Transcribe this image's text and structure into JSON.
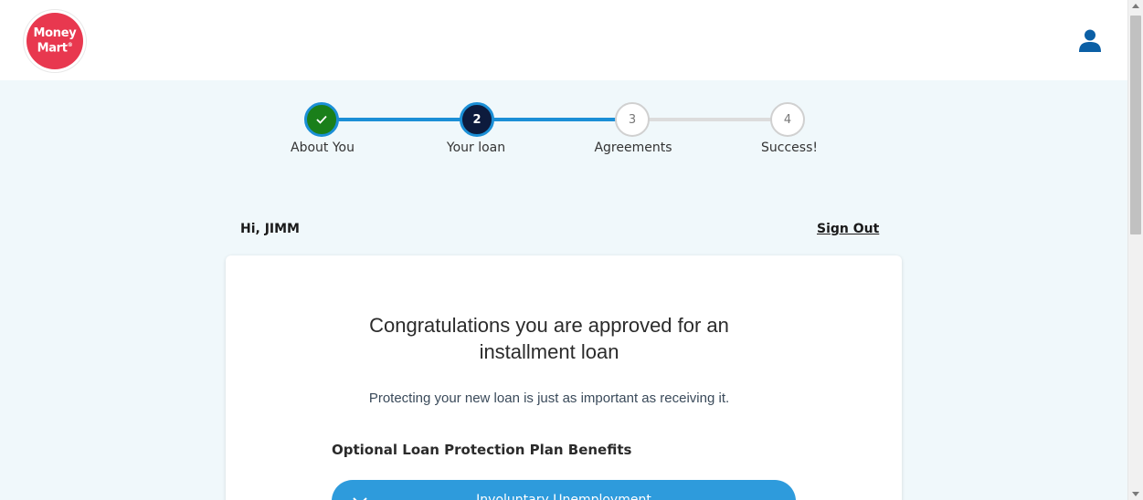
{
  "header": {
    "logo_line1": "Money",
    "logo_line2": "Mart",
    "logo_mark": "®"
  },
  "stepper": {
    "steps": [
      {
        "number": "✓",
        "label": "About You",
        "state": "complete"
      },
      {
        "number": "2",
        "label": "Your loan",
        "state": "current"
      },
      {
        "number": "3",
        "label": "Agreements",
        "state": "upcoming"
      },
      {
        "number": "4",
        "label": "Success!",
        "state": "upcoming"
      }
    ]
  },
  "account": {
    "greeting": "Hi, JIMM",
    "sign_out": "Sign Out"
  },
  "card": {
    "title_line1": "Congratulations you are approved for an",
    "title_line2": "installment loan",
    "subtitle": "Protecting your new loan is just as important as receiving it.",
    "section_heading": "Optional Loan Protection Plan Benefits",
    "accordion_label": "Involuntary Unemployment"
  },
  "colors": {
    "brand_red": "#e8384f",
    "step_complete": "#1a7f1a",
    "step_current": "#0d1b3d",
    "progress": "#1b8fd6",
    "accordion": "#2e9bdc",
    "background": "#f0f8fb"
  },
  "icons": {
    "user": "user-icon",
    "check": "check-icon",
    "chevron": "chevron-down-icon"
  }
}
